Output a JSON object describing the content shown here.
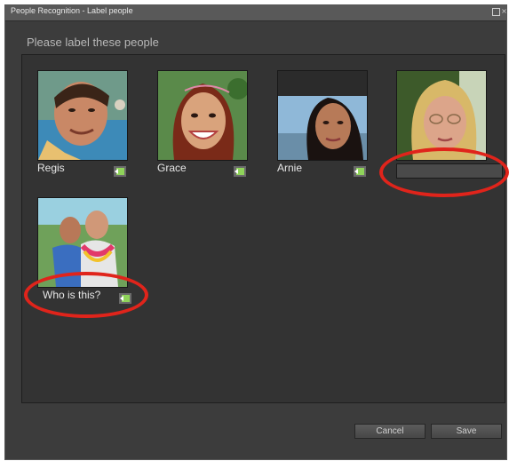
{
  "window": {
    "title": "People Recognition - Label people"
  },
  "dialog": {
    "heading": "Please label these people"
  },
  "people": [
    {
      "name": "Regis"
    },
    {
      "name": "Grace"
    },
    {
      "name": "Arnie"
    },
    {
      "name": ""
    },
    {
      "name": "Who is this?"
    }
  ],
  "buttons": {
    "cancel": "Cancel",
    "save": "Save"
  },
  "colors": {
    "highlight_ring": "#e0241b",
    "panel_bg": "#333333",
    "window_bg": "#3c3c3c"
  },
  "icons": {
    "tag": "add-tag-icon",
    "maximize": "maximize-icon",
    "close": "close-icon"
  }
}
